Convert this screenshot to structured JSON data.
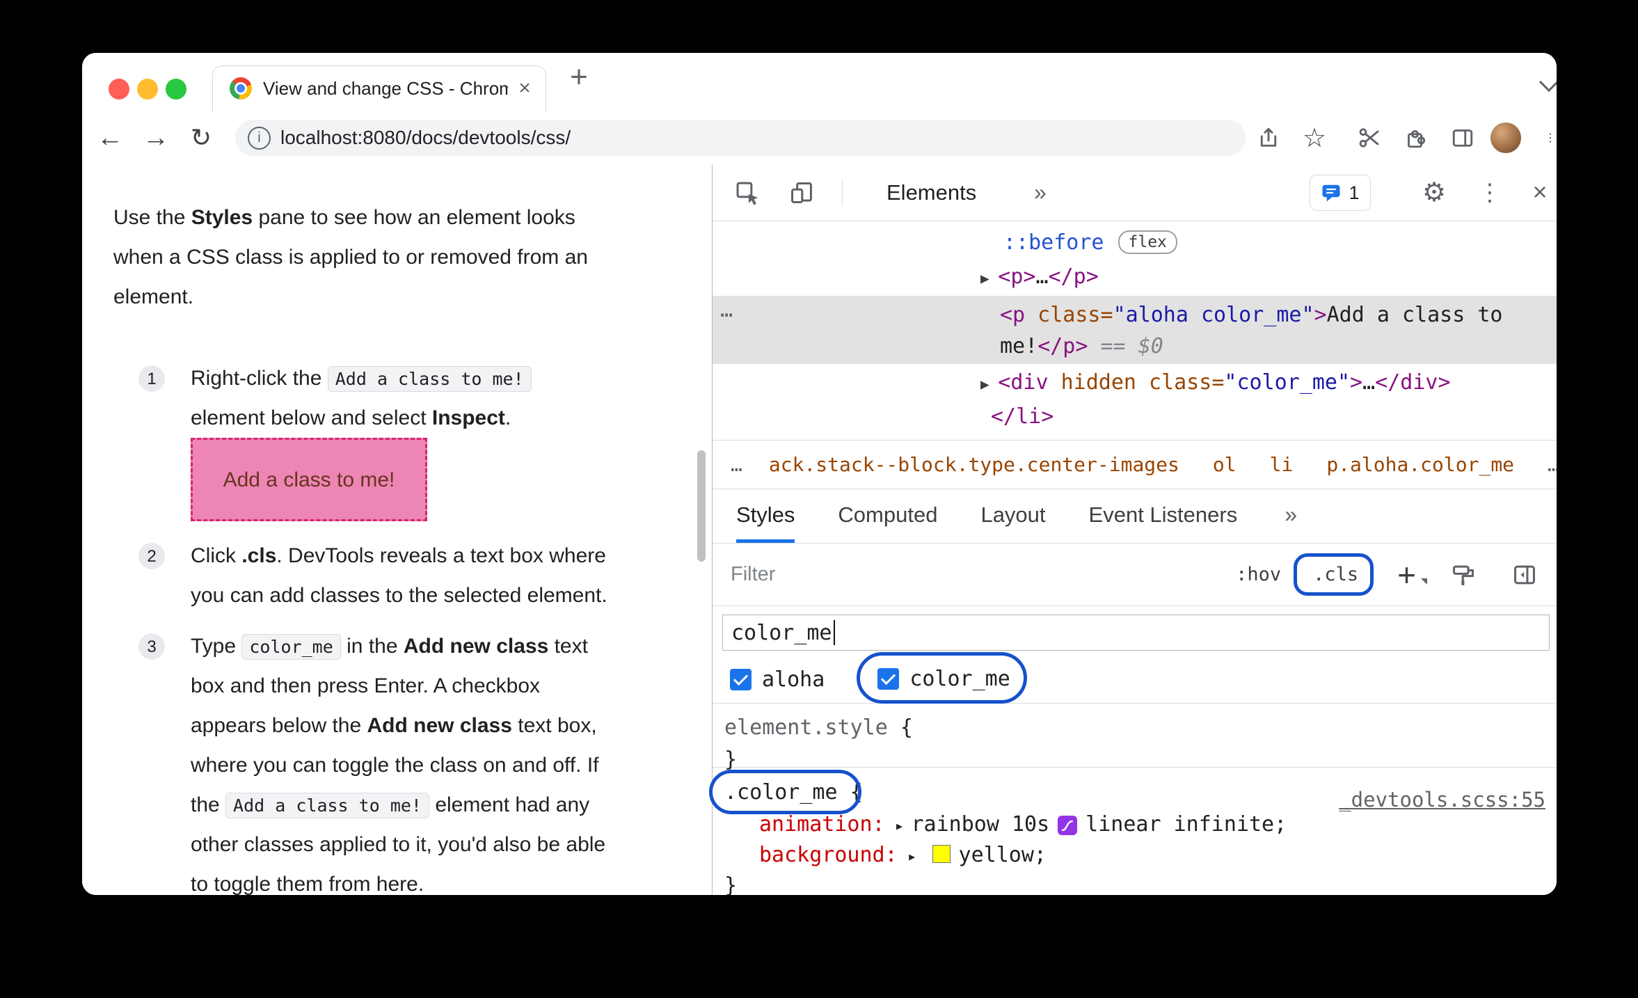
{
  "window": {
    "tab_title": "View and change CSS - Chrom",
    "url": "localhost:8080/docs/devtools/css/"
  },
  "icons": {
    "back": "←",
    "forward": "→",
    "reload": "↻",
    "info": "i",
    "star": "☆",
    "menu_dots": "⋮",
    "new_tab": "+",
    "tab_close": "×",
    "devtools_close": "×",
    "gear": "⚙",
    "more_tabs": "»",
    "crumb_ellipsis": "…",
    "row_more": "⋯",
    "shorthand_arrow": "▸"
  },
  "page": {
    "intro": [
      [
        {
          "t": "Use the ",
          "c": "txt"
        },
        {
          "t": "Styles",
          "c": "b"
        },
        {
          "t": " pane to see how an element looks",
          "c": "txt"
        }
      ],
      [
        {
          "t": "when a CSS class is applied to or removed from an",
          "c": "txt"
        }
      ],
      [
        {
          "t": "element.",
          "c": "txt"
        }
      ]
    ],
    "steps": [
      {
        "num": "1",
        "lines": [
          [
            {
              "t": "Right-click the ",
              "c": "txt"
            },
            {
              "t": "Add a class to me!",
              "c": "code"
            }
          ],
          [
            {
              "t": "element below and select ",
              "c": "txt"
            },
            {
              "t": "Inspect",
              "c": "b"
            },
            {
              "t": ".",
              "c": "txt"
            }
          ]
        ]
      },
      {
        "num": "2",
        "lines": [
          [
            {
              "t": "Click ",
              "c": "txt"
            },
            {
              "t": ".cls",
              "c": "b"
            },
            {
              "t": ". DevTools reveals a text box where",
              "c": "txt"
            }
          ],
          [
            {
              "t": "you can add classes to the selected element.",
              "c": "txt"
            }
          ]
        ]
      },
      {
        "num": "3",
        "lines": [
          [
            {
              "t": "Type ",
              "c": "txt"
            },
            {
              "t": "color_me",
              "c": "code"
            },
            {
              "t": " in the ",
              "c": "txt"
            },
            {
              "t": "Add new class",
              "c": "b"
            },
            {
              "t": " text",
              "c": "txt"
            }
          ],
          [
            {
              "t": "box and then press Enter. A checkbox",
              "c": "txt"
            }
          ],
          [
            {
              "t": "appears below the ",
              "c": "txt"
            },
            {
              "t": "Add new class",
              "c": "b"
            },
            {
              "t": " text box,",
              "c": "txt"
            }
          ],
          [
            {
              "t": "where you can toggle the class on and off. If",
              "c": "txt"
            }
          ],
          [
            {
              "t": "the ",
              "c": "txt"
            },
            {
              "t": "Add a class to me!",
              "c": "code"
            },
            {
              "t": " element had any",
              "c": "txt"
            }
          ],
          [
            {
              "t": "other classes applied to it, you'd also be able",
              "c": "txt"
            }
          ],
          [
            {
              "t": "to toggle them from here.",
              "c": "txt"
            }
          ]
        ]
      }
    ],
    "demo_text": "Add a class to me!"
  },
  "devtools": {
    "panel_tab": "Elements",
    "badge_count": "1",
    "dom_badge": "flex",
    "dom_rows": {
      "r1": [
        {
          "t": "::before",
          "c": "pseudo"
        }
      ],
      "r2": [
        {
          "t": "▶ ",
          "c": "arrow"
        },
        {
          "t": "<p>",
          "c": "tag"
        },
        {
          "t": "…",
          "c": "txt"
        },
        {
          "t": "</p>",
          "c": "tag"
        }
      ],
      "sel1": [
        {
          "t": "<p",
          "c": "tag"
        },
        {
          "t": " class=",
          "c": "attr"
        },
        {
          "t": "\"aloha color_me\"",
          "c": "val"
        },
        {
          "t": ">",
          "c": "tag"
        },
        {
          "t": "Add a class to",
          "c": "txt"
        }
      ],
      "sel2": [
        {
          "t": "me!",
          "c": "txt"
        },
        {
          "t": "</p>",
          "c": "tag"
        },
        {
          "t": " == ",
          "c": "eq"
        },
        {
          "t": "$0",
          "c": "dollar"
        }
      ],
      "r4": [
        {
          "t": "▶ ",
          "c": "arrow"
        },
        {
          "t": "<div",
          "c": "tag"
        },
        {
          "t": " hidden",
          "c": "attr"
        },
        {
          "t": " class=",
          "c": "attr"
        },
        {
          "t": "\"color_me\"",
          "c": "val"
        },
        {
          "t": ">",
          "c": "tag"
        },
        {
          "t": "…",
          "c": "txt"
        },
        {
          "t": "</div>",
          "c": "tag"
        }
      ],
      "r5": [
        {
          "t": "</li>",
          "c": "tag"
        }
      ]
    },
    "breadcrumbs": [
      "ack.stack--block.type.center-images",
      "ol",
      "li",
      "p.aloha.color_me"
    ],
    "tabs": [
      "Styles",
      "Computed",
      "Layout",
      "Event Listeners"
    ],
    "filter_placeholder": "Filter",
    "hov": ":hov",
    "cls": ".cls",
    "new_class_value": "color_me",
    "checkboxes": {
      "first": "aloha",
      "second": "color_me"
    },
    "styles": {
      "element_style": "element.style",
      "open_brace": " {",
      "close_brace": "}",
      "selector": ".color_me",
      "source_link": "_devtools.scss:55",
      "prop1": {
        "name": "animation:",
        "value_pre": "rainbow 10s",
        "value_post": "linear infinite;"
      },
      "prop2": {
        "name": "background:",
        "value": "yellow;"
      }
    }
  },
  "colors": {
    "annotation_blue": "#1552cc",
    "accent_blue": "#1a73e8",
    "tag_purple": "#881280",
    "attr_orange": "#994500",
    "value_blue": "#1a1aa6",
    "property_red": "#c80000",
    "pink_bg": "#ee86b5",
    "pink_border": "#d6246e",
    "swatch_yellow": "#ffff00",
    "anim_icon_purple": "#9334e6",
    "selected_row_bg": "#e2e2e2"
  }
}
